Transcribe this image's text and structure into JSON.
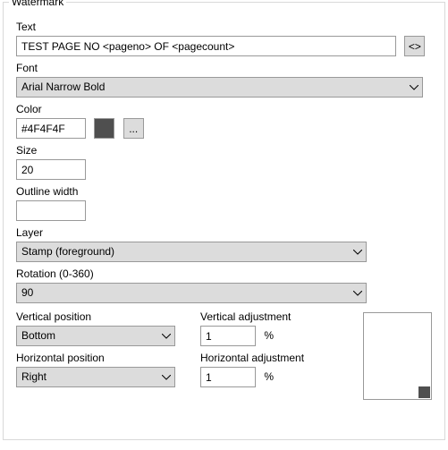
{
  "group": {
    "title": "Watermark"
  },
  "text": {
    "label": "Text",
    "value": "TEST PAGE NO <pageno> OF <pagecount>",
    "insert_btn": "<>"
  },
  "font": {
    "label": "Font",
    "value": "Arial Narrow Bold"
  },
  "color": {
    "label": "Color",
    "value": "#4F4F4F",
    "hex": "#4F4F4F",
    "ellipsis": "..."
  },
  "size": {
    "label": "Size",
    "value": "20"
  },
  "outline": {
    "label": "Outline width",
    "value": ""
  },
  "layer": {
    "label": "Layer",
    "value": "Stamp (foreground)"
  },
  "rotation": {
    "label": "Rotation (0-360)",
    "value": "90"
  },
  "vpos": {
    "label": "Vertical position",
    "value": "Bottom"
  },
  "vadj": {
    "label": "Vertical adjustment",
    "value": "1",
    "unit": "%"
  },
  "hpos": {
    "label": "Horizontal position",
    "value": "Right"
  },
  "hadj": {
    "label": "Horizontal adjustment",
    "value": "1",
    "unit": "%"
  }
}
